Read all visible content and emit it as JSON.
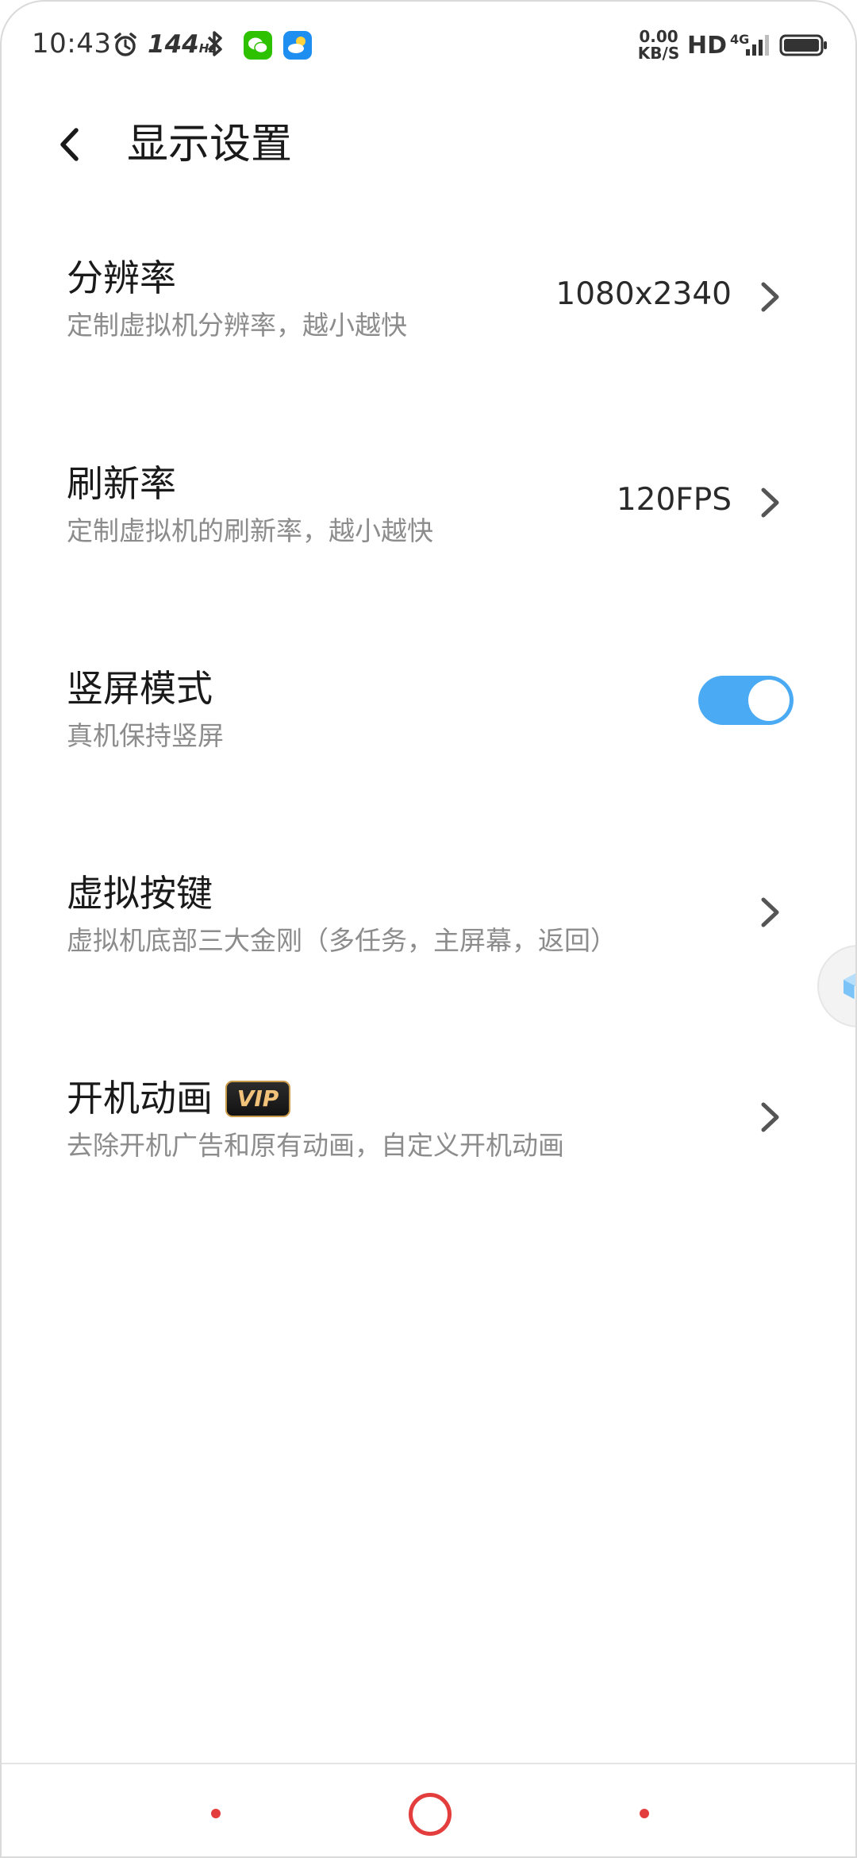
{
  "status_bar": {
    "time": "10:43",
    "refresh_rate": "144",
    "refresh_unit": "Hz",
    "net_speed_value": "0.00",
    "net_speed_unit": "KB/S",
    "hd_label": "HD",
    "network_type": "4G",
    "icons": [
      "alarm-icon",
      "bluetooth-icon",
      "wechat-icon",
      "weather-icon",
      "signal-icon",
      "battery-icon"
    ]
  },
  "header": {
    "title": "显示设置",
    "back_icon": "chevron-left-icon"
  },
  "settings": {
    "resolution": {
      "title": "分辨率",
      "subtitle": "定制虚拟机分辨率，越小越快",
      "value": "1080x2340"
    },
    "refresh": {
      "title": "刷新率",
      "subtitle": "定制虚拟机的刷新率，越小越快",
      "value": "120FPS"
    },
    "portrait": {
      "title": "竖屏模式",
      "subtitle": "真机保持竖屏",
      "enabled": true
    },
    "virtual_keys": {
      "title": "虚拟按键",
      "subtitle": "虚拟机底部三大金刚（多任务，主屏幕，返回）"
    },
    "boot_animation": {
      "title": "开机动画",
      "badge": "VIP",
      "subtitle": "去除开机广告和原有动画，自定义开机动画"
    }
  },
  "colors": {
    "accent": "#4aaaf3",
    "nav_red": "#e43d3d",
    "vip_gold": "#f1c27a"
  }
}
